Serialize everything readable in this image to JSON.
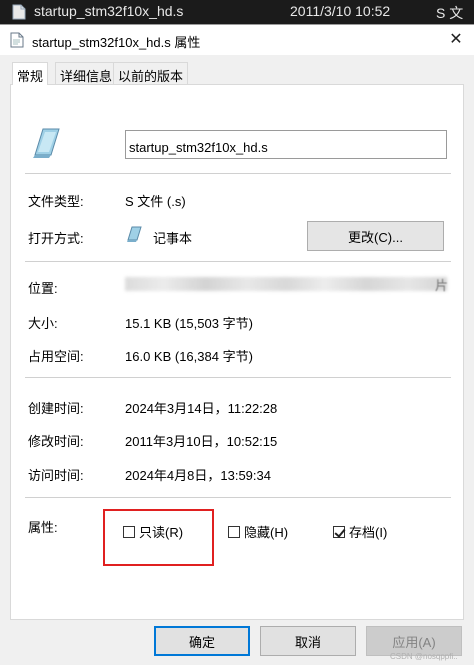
{
  "background_row": {
    "file_name": "startup_stm32f10x_hd.s",
    "modified": "2011/3/10 10:52",
    "type": "S 文"
  },
  "dialog": {
    "title": "startup_stm32f10x_hd.s 属性",
    "close_glyph": "✕",
    "tabs": [
      {
        "label": "常规",
        "active": true
      },
      {
        "label": "详细信息",
        "active": false
      },
      {
        "label": "以前的版本",
        "active": false
      }
    ],
    "general": {
      "file_name": "startup_stm32f10x_hd.s",
      "file_type_label": "文件类型:",
      "file_type_value": "S 文件 (.s)",
      "opens_with_label": "打开方式:",
      "opens_with_value": "记事本",
      "change_button": "更改(C)...",
      "location_label": "位置:",
      "location_tail": "片",
      "size_label": "大小:",
      "size_value": "15.1 KB (15,503 字节)",
      "size_on_disk_label": "占用空间:",
      "size_on_disk_value": "16.0 KB (16,384 字节)",
      "created_label": "创建时间:",
      "created_value": "2024年3月14日，11:22:28",
      "modified_label": "修改时间:",
      "modified_value": "2011年3月10日，10:52:15",
      "accessed_label": "访问时间:",
      "accessed_value": "2024年4月8日，13:59:34",
      "attributes_label": "属性:",
      "attributes": [
        {
          "label": "只读(R)",
          "checked": false
        },
        {
          "label": "隐藏(H)",
          "checked": false
        },
        {
          "label": "存档(I)",
          "checked": true
        }
      ]
    },
    "buttons": {
      "ok": "确定",
      "cancel": "取消",
      "apply": "应用(A)"
    }
  },
  "watermark": "CSDN @nosqppfi..",
  "colors": {
    "highlight_box": "#e02020",
    "panel_bg": "#ffffff",
    "dialog_bg": "#f0f0f0"
  }
}
